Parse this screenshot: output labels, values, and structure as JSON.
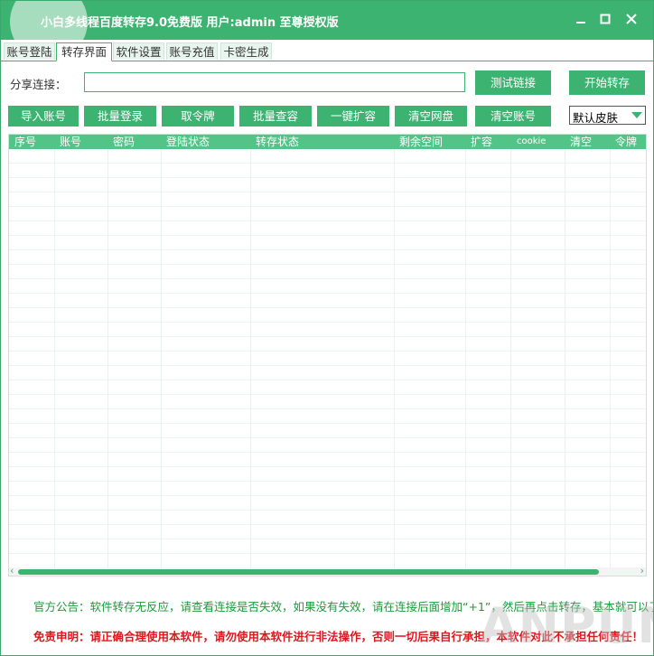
{
  "window": {
    "title": "小白多线程百度转存9.0免费版 用户:admin 至尊授权版"
  },
  "tabs": [
    {
      "label": "账号登陆"
    },
    {
      "label": "转存界面"
    },
    {
      "label": "软件设置"
    },
    {
      "label": "账号充值"
    },
    {
      "label": "卡密生成"
    }
  ],
  "share": {
    "label": "分享连接：",
    "value": "",
    "placeholder": ""
  },
  "buttons": {
    "test_link": "测试链接",
    "start_transfer": "开始转存",
    "import_accounts": "导入账号",
    "batch_login": "批量登录",
    "get_token": "取令牌",
    "batch_check_capacity": "批量查容",
    "one_click_expand": "一键扩容",
    "clear_netdisk": "清空网盘",
    "clear_accounts": "清空账号"
  },
  "skin": {
    "selected": "默认皮肤"
  },
  "table": {
    "columns": [
      "序号",
      "账号",
      "密码",
      "登陆状态",
      "转存状态",
      "剩余空间",
      "扩容",
      "cookie",
      "清空",
      "令牌"
    ],
    "rows": []
  },
  "footer": {
    "notice": "官方公告：软件转存无反应，请查看连接是否失效，如果没有失效，请在连接后面增加“+1”，然后再点击转存，基本就可以了",
    "disclaimer": "免责申明：请正确合理使用本软件，请勿使用本软件进行非法操作，否则一切后果自行承担，本软件对此不承担任何责任！"
  },
  "watermark": "ANPUN",
  "colors": {
    "accent": "#3cb371",
    "header": "#52c487",
    "notice": "#1a9b3a",
    "disclaimer": "#e0161e"
  }
}
